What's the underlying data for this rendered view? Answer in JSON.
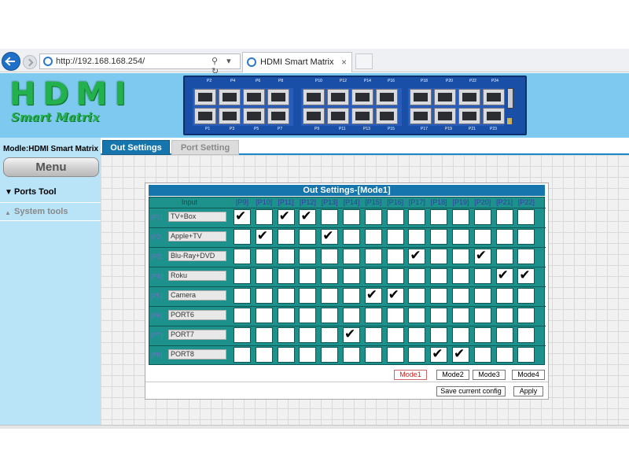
{
  "browser": {
    "url": "http://192.168.168.254/",
    "address_tools": "⚲ ▾ ↻",
    "tab_title": "HDMI Smart Matrix",
    "tab_close": "×"
  },
  "header": {
    "logo_main": "HDMI",
    "logo_sub": "Smart Matrix",
    "switch_top_labels": [
      "P2",
      "P4",
      "P6",
      "P8",
      "P10",
      "P12",
      "P14",
      "P16",
      "P18",
      "P20",
      "P22",
      "P24"
    ],
    "switch_bottom_labels": [
      "P1",
      "P3",
      "P5",
      "P7",
      "P9",
      "P11",
      "P13",
      "P15",
      "P17",
      "P19",
      "P21",
      "P23"
    ]
  },
  "sidebar": {
    "title": "Modle:HDMI Smart Matrix",
    "menu_label": "Menu",
    "ports_tool_arrow": "▼",
    "ports_tool_label": "Ports Tool",
    "system_tools_arrow": "▲",
    "system_tools_label": "System tools"
  },
  "tabs": {
    "out_settings": "Out Settings",
    "port_setting": "Port Setting"
  },
  "panel": {
    "title": "Out Settings-[Mode1]",
    "input_header": "Input",
    "outputs": [
      "[P9]",
      "[P10]",
      "[P11]",
      "[P12]",
      "[P13]",
      "[P14]",
      "[P15]",
      "[P16]",
      "[P17]",
      "[P18]",
      "[P19]",
      "[P20]",
      "[P21]",
      "[P22]"
    ],
    "rows": [
      {
        "label": "[P1]:",
        "name": "TV+Box",
        "checks": [
          1,
          0,
          1,
          1,
          0,
          0,
          0,
          0,
          0,
          0,
          0,
          0,
          0,
          0
        ]
      },
      {
        "label": "[P2]:",
        "name": "Apple+TV",
        "checks": [
          0,
          1,
          0,
          0,
          1,
          0,
          0,
          0,
          0,
          0,
          0,
          0,
          0,
          0
        ]
      },
      {
        "label": "[P3]:",
        "name": "Blu-Ray+DVD",
        "checks": [
          0,
          0,
          0,
          0,
          0,
          0,
          0,
          0,
          1,
          0,
          0,
          1,
          0,
          0
        ]
      },
      {
        "label": "[P4]:",
        "name": "Roku",
        "checks": [
          0,
          0,
          0,
          0,
          0,
          0,
          0,
          0,
          0,
          0,
          0,
          0,
          1,
          1
        ]
      },
      {
        "label": "[P5]:",
        "name": "Camera",
        "checks": [
          0,
          0,
          0,
          0,
          0,
          0,
          1,
          1,
          0,
          0,
          0,
          0,
          0,
          0
        ]
      },
      {
        "label": "[P6]:",
        "name": "PORT6",
        "checks": [
          0,
          0,
          0,
          0,
          0,
          0,
          0,
          0,
          0,
          0,
          0,
          0,
          0,
          0
        ]
      },
      {
        "label": "[P7]:",
        "name": "PORT7",
        "checks": [
          0,
          0,
          0,
          0,
          0,
          1,
          0,
          0,
          0,
          0,
          0,
          0,
          0,
          0
        ]
      },
      {
        "label": "[P8]:",
        "name": "PORT8",
        "checks": [
          0,
          0,
          0,
          0,
          0,
          0,
          0,
          0,
          0,
          1,
          1,
          0,
          0,
          0
        ]
      }
    ],
    "modes": [
      "Mode1",
      "Mode2",
      "Mode3",
      "Mode4"
    ],
    "active_mode": "Mode1",
    "save_label": "Save current config",
    "apply_label": "Apply"
  }
}
